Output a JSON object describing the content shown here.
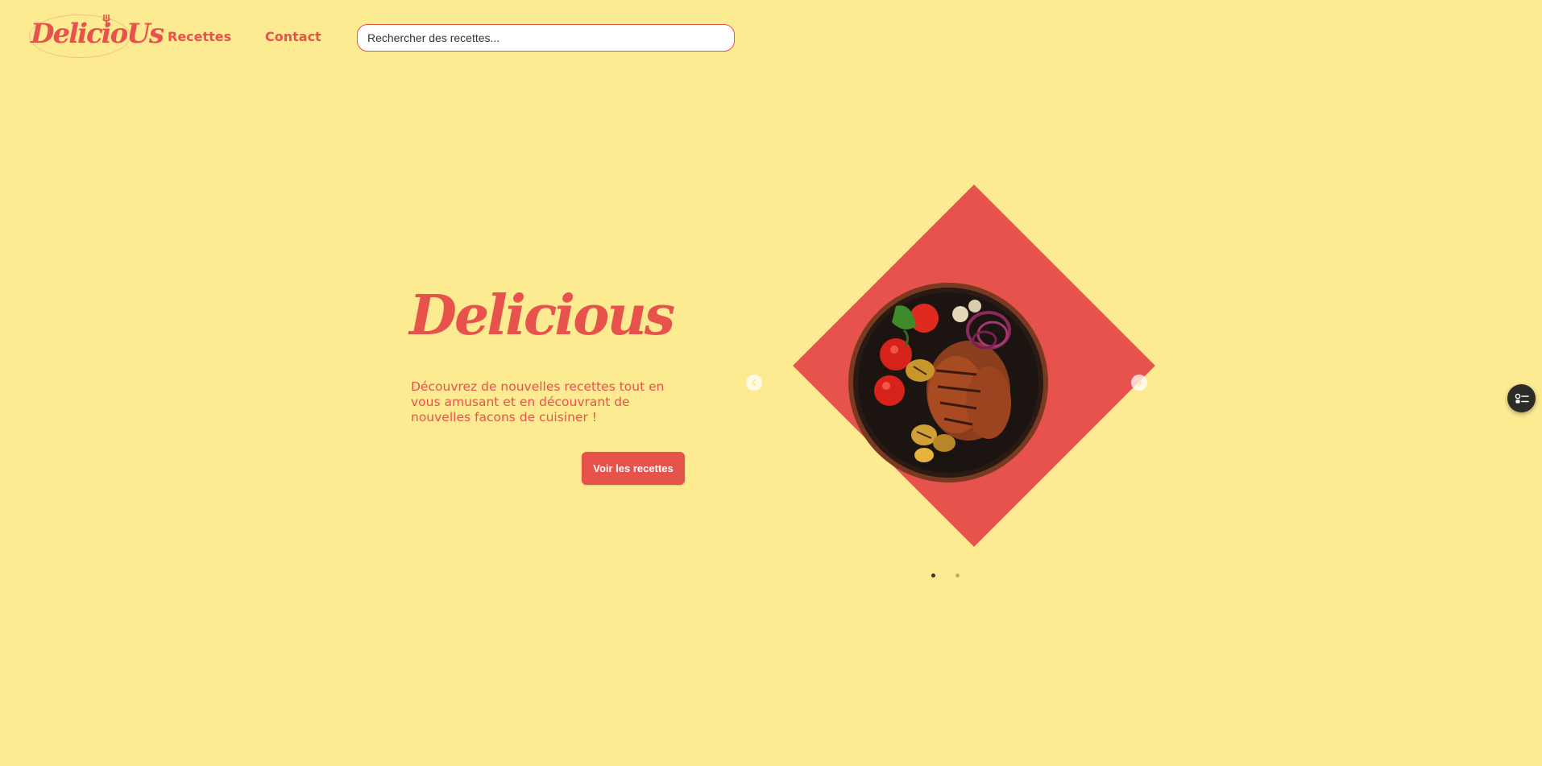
{
  "header": {
    "logo_text": "DelicioUs",
    "nav": {
      "recettes": "Recettes",
      "contact": "Contact"
    },
    "search": {
      "placeholder": "Rechercher des recettes..."
    }
  },
  "hero": {
    "title": "Delicious",
    "description": "Découvrez de nouvelles recettes tout en vous amusant et en découvrant de nouvelles facons de cuisiner !",
    "cta_label": "Voir les recettes"
  },
  "carousel": {
    "slide_count": 2,
    "active_slide": 1,
    "image": "grilled-chicken-vegetables-bowl",
    "prev_icon": "chevron-left-icon",
    "next_icon": "chevron-right-icon"
  },
  "widget": {
    "icon": "toggle-list-icon"
  },
  "colors": {
    "background": "#fdeb91",
    "accent": "#e8524c",
    "widget": "#2b2b28"
  }
}
